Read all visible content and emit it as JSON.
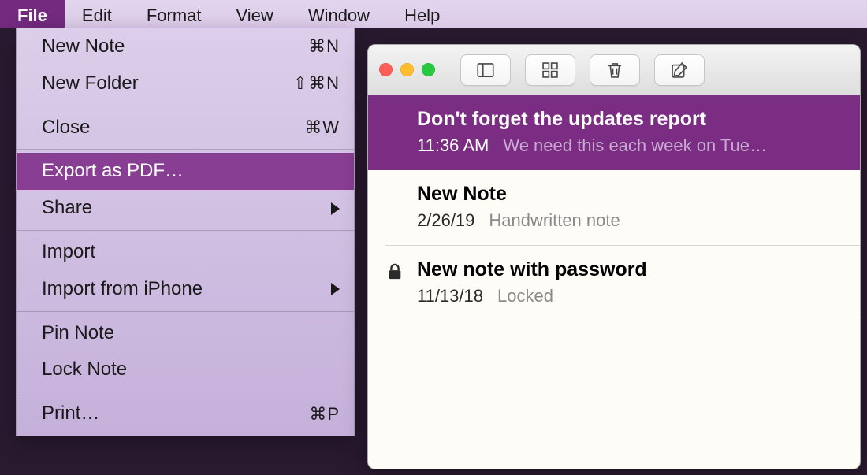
{
  "menubar": {
    "items": [
      {
        "label": "File",
        "active": true
      },
      {
        "label": "Edit",
        "active": false
      },
      {
        "label": "Format",
        "active": false
      },
      {
        "label": "View",
        "active": false
      },
      {
        "label": "Window",
        "active": false
      },
      {
        "label": "Help",
        "active": false
      }
    ]
  },
  "file_menu": {
    "new_note": {
      "label": "New Note",
      "shortcut": "⌘N"
    },
    "new_folder": {
      "label": "New Folder",
      "shortcut": "⇧⌘N"
    },
    "close": {
      "label": "Close",
      "shortcut": "⌘W"
    },
    "export_pdf": {
      "label": "Export as PDF…",
      "highlight": true
    },
    "share": {
      "label": "Share",
      "submenu": true
    },
    "import": {
      "label": "Import"
    },
    "import_iphone": {
      "label": "Import from iPhone",
      "submenu": true
    },
    "pin_note": {
      "label": "Pin Note"
    },
    "lock_note": {
      "label": "Lock Note"
    },
    "print": {
      "label": "Print…",
      "shortcut": "⌘P"
    }
  },
  "toolbar": {
    "sidebar_btn": "toggle-sidebar",
    "grid_btn": "grid-view",
    "trash_btn": "delete-note",
    "compose_btn": "new-note"
  },
  "notes": [
    {
      "title": "Don't forget the updates report",
      "date": "11:36 AM",
      "preview": "We need this each week on Tue…",
      "selected": true,
      "locked": false
    },
    {
      "title": "New Note",
      "date": "2/26/19",
      "preview": "Handwritten note",
      "selected": false,
      "locked": false
    },
    {
      "title": "New note with password",
      "date": "11/13/18",
      "preview": "Locked",
      "selected": false,
      "locked": true
    }
  ]
}
